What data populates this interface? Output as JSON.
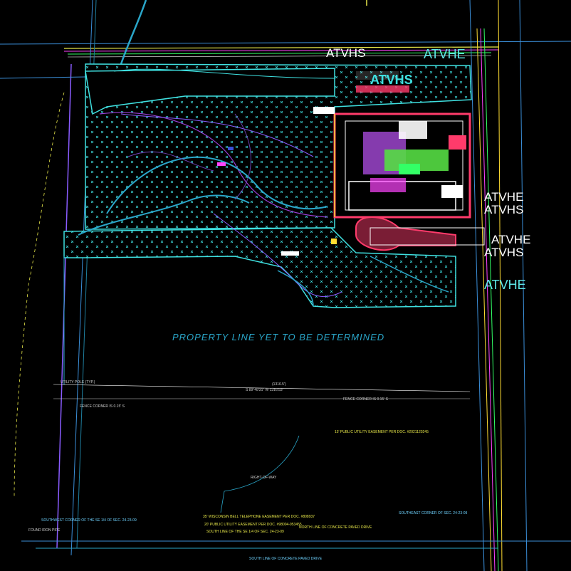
{
  "drawing": {
    "property_line_note": "PROPERTY LINE YET TO BE DETERMINED",
    "markers": {
      "atvhs_top": "ATVHS",
      "atvhe_top": "ATVHE",
      "atvhs_green": "ATVHS",
      "atvhe_right_1": "ATVHE",
      "atvhs_right_1": "ATVHS",
      "atvhe_right_2": "ATVHE",
      "atvhs_right_2": "ATVHS",
      "atvhe_right_3": "ATVHE"
    },
    "notes": {
      "easement_15": "15' PUBLIC UTILITY EASEMENT PER DOC. #2021120245",
      "bell_easement": "35' WISCONSIN BELL TELEPHONE EASEMENT PER DOC. #808937",
      "utility_easement_20": "20' PUBLIC UTILITY EASEMENT PER DOC. #98004-953455",
      "south_line": "SOUTH LINE OF THE SE 1/4 OF SEC. 24-23-09",
      "north_line": "NORTH LINE OF CONCRETE PAVED DRIVE",
      "south_line_paved": "SOUTH LINE OF CONCRETE PAVED DRIVE",
      "fence_corner_left": "FENCE CORNER IS 0.15' S",
      "fence_corner_right": "FENCE CORNER IS 0.15' S",
      "southwest_corner": "SOUTHWEST CORNER OF THE SE 1/4 OF SEC. 24-23-09",
      "found_iron_pipe": "FOUND IRON PIPE",
      "southeast_corner": "SOUTHEAST CORNER OF SEC. 24-23-09",
      "right_of_way": "RIGHT-OF-WAY",
      "utility_pole": "UTILITY POLE (TYP.)",
      "bearing_south": "S 89°48'31\" W  1316.53'",
      "survey_record": "(1316.5')"
    }
  }
}
